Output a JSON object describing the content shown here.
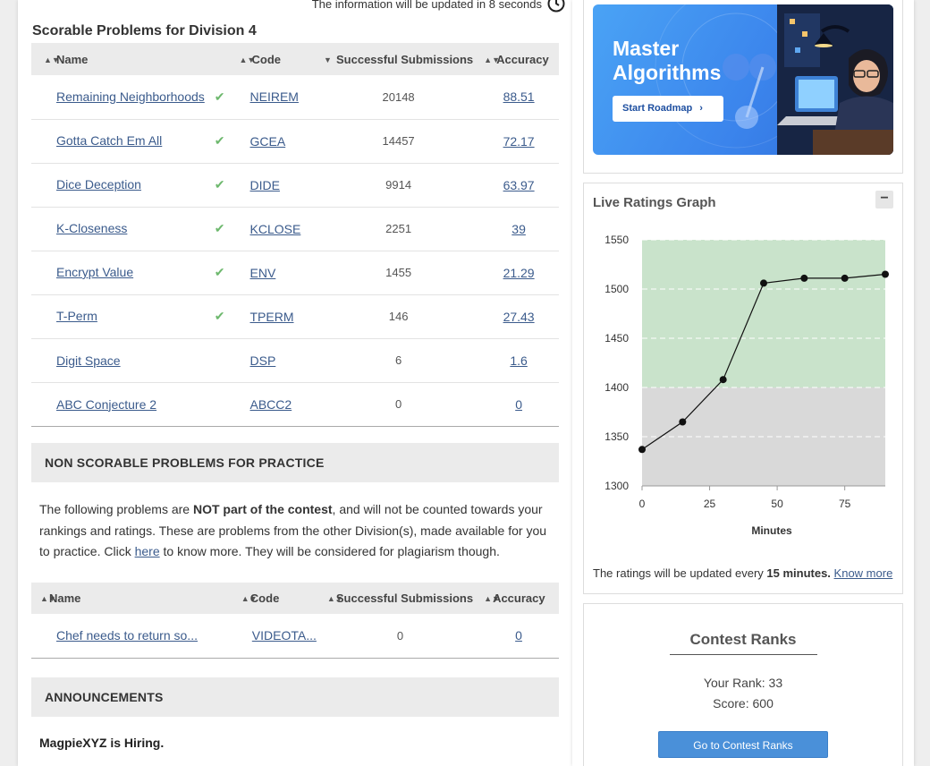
{
  "update_note": "The information will be updated in 8 seconds",
  "scorable": {
    "title": "Scorable Problems for Division 4",
    "headers": {
      "name": "Name",
      "code": "Code",
      "subs": "Successful Submissions",
      "acc": "Accuracy"
    },
    "rows": [
      {
        "name": "Remaining Neighborhoods",
        "solved": true,
        "code": "NEIREM",
        "subs": "20148",
        "acc": "88.51"
      },
      {
        "name": "Gotta Catch Em All",
        "solved": true,
        "code": "GCEA",
        "subs": "14457",
        "acc": "72.17"
      },
      {
        "name": "Dice Deception",
        "solved": true,
        "code": "DIDE",
        "subs": "9914",
        "acc": "63.97"
      },
      {
        "name": "K-Closeness",
        "solved": true,
        "code": "KCLOSE",
        "subs": "2251",
        "acc": "39"
      },
      {
        "name": "Encrypt Value",
        "solved": true,
        "code": "ENV",
        "subs": "1455",
        "acc": "21.29"
      },
      {
        "name": "T-Perm",
        "solved": true,
        "code": "TPERM",
        "subs": "146",
        "acc": "27.43"
      },
      {
        "name": "Digit Space",
        "solved": false,
        "code": "DSP",
        "subs": "6",
        "acc": "1.6"
      },
      {
        "name": "ABC Conjecture 2",
        "solved": false,
        "code": "ABCC2",
        "subs": "0",
        "acc": "0"
      }
    ]
  },
  "non_scorable": {
    "header": "NON SCORABLE PROBLEMS FOR PRACTICE",
    "para_1": "The following problems are ",
    "para_bold": "NOT part of the contest",
    "para_2": ", and will not be counted towards your rankings and ratings. These are problems from the other Division(s), made available for you to practice. Click ",
    "para_link": "here",
    "para_3": " to know more. They will be considered for plagiarism though.",
    "headers": {
      "name": "Name",
      "code": "Code",
      "subs": "Successful Submissions",
      "acc": "Accuracy"
    },
    "rows": [
      {
        "name": "Chef needs to return so...",
        "code": "VIDEOTA...",
        "subs": "0",
        "acc": "0"
      }
    ]
  },
  "announcements": {
    "header": "ANNOUNCEMENTS",
    "first": "MagpieXYZ is Hiring."
  },
  "promo": {
    "title_line1": "Master",
    "title_line2": "Algorithms",
    "button": "Start Roadmap"
  },
  "graph": {
    "title": "Live Ratings Graph",
    "collapse": "−",
    "foot_1": "The ratings will be updated every ",
    "foot_bold": "15 minutes.",
    "foot_link": "Know more"
  },
  "chart_data": {
    "type": "line",
    "title": "Live Ratings Graph",
    "xlabel": "Minutes",
    "ylabel": "",
    "xlim": [
      0,
      90
    ],
    "ylim": [
      1300,
      1550
    ],
    "xticks": [
      0,
      25,
      50,
      75
    ],
    "yticks": [
      1300,
      1350,
      1400,
      1450,
      1500,
      1550
    ],
    "x": [
      0,
      15,
      30,
      45,
      60,
      75,
      90
    ],
    "y": [
      1337,
      1365,
      1408,
      1506,
      1511,
      1511,
      1515
    ],
    "bands": [
      {
        "from": 1300,
        "to": 1400,
        "color": "#d9d9d9"
      },
      {
        "from": 1400,
        "to": 1550,
        "color": "#c9e3cb"
      }
    ]
  },
  "ranks": {
    "title": "Contest Ranks",
    "rank_label": "Your Rank: 33",
    "score_label": "Score: 600",
    "button": "Go to Contest Ranks"
  }
}
